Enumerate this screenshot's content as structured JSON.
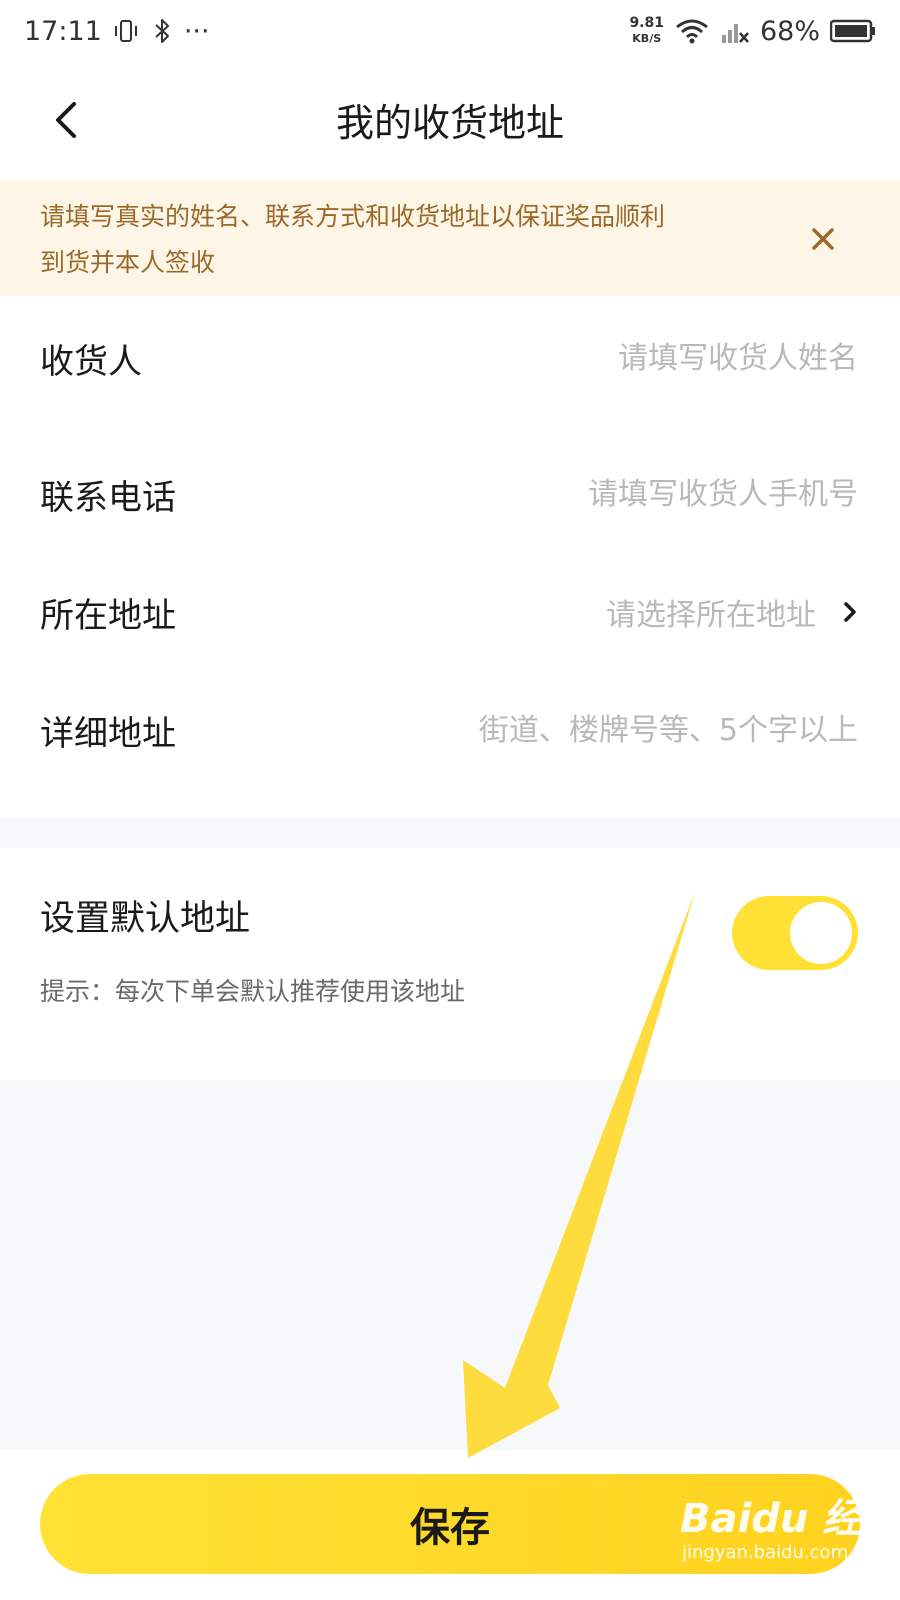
{
  "statusbar": {
    "time": "17:11",
    "more": "···",
    "net_speed_value": "9.81",
    "net_speed_unit": "KB/S",
    "battery": "68%"
  },
  "header": {
    "title": "我的收货地址"
  },
  "notice": {
    "text_line1": "请填写真实的姓名、联系方式和收货地址以保证奖品顺利",
    "text_line2": "到货并本人签收"
  },
  "form": {
    "receiver": {
      "label": "收货人",
      "placeholder": "请填写收货人姓名"
    },
    "phone": {
      "label": "联系电话",
      "placeholder": "请填写收货人手机号"
    },
    "region": {
      "label": "所在地址",
      "placeholder": "请选择所在地址"
    },
    "detail": {
      "label": "详细地址",
      "placeholder": "街道、楼牌号等、5个字以上"
    }
  },
  "default_address": {
    "label": "设置默认地址",
    "hint": "提示：每次下单会默认推荐使用该地址",
    "enabled": true
  },
  "actions": {
    "save_label": "保存"
  },
  "watermark": {
    "brand": "Baidu 经验",
    "url": "jingyan.baidu.com"
  },
  "colors": {
    "accent": "#ffe135",
    "notice_bg": "#fdf5e6",
    "notice_text": "#9b6a2a",
    "placeholder": "#b9b9b9",
    "page_bg": "#f7f8f9"
  },
  "icons": {
    "back": "chevron-left-icon",
    "close": "close-icon",
    "forward": "chevron-right-icon",
    "vibrate": "vibrate-icon",
    "bluetooth": "bluetooth-icon",
    "wifi": "wifi-icon",
    "signal": "signal-icon",
    "battery": "battery-icon"
  }
}
